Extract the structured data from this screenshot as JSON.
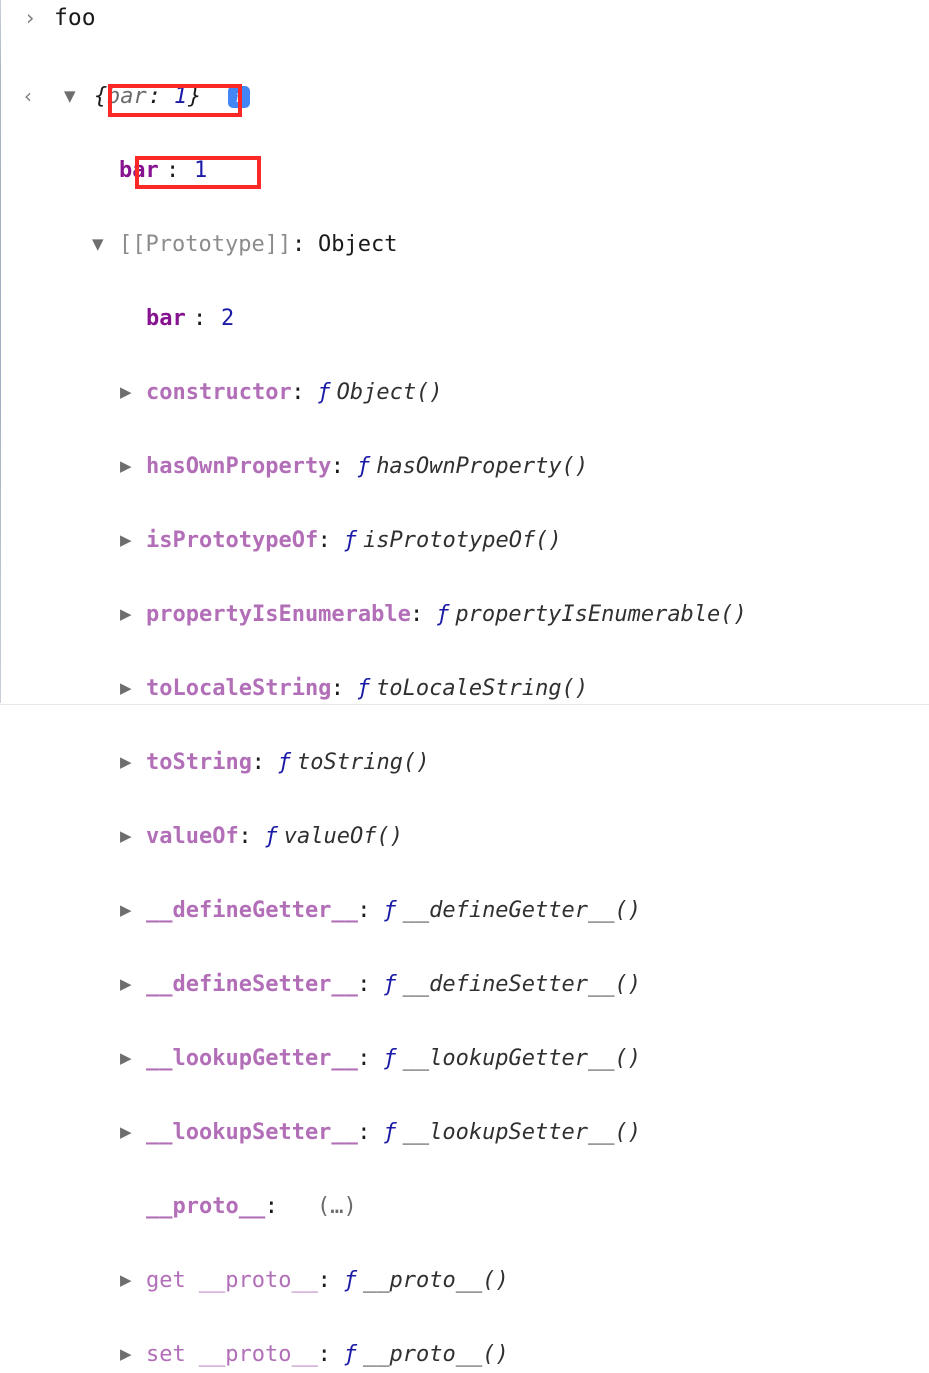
{
  "console": {
    "prompt_icon": "chevron-right",
    "result_icon": "chevron-left-dot",
    "input_expression": "foo",
    "result_preview": {
      "brace_open": "{",
      "key": "bar",
      "colon": ":",
      "value": "1",
      "brace_close": "}",
      "info_badge": "i"
    },
    "own_property": {
      "key": "bar",
      "colon": ":",
      "value": "1"
    },
    "prototype_header": {
      "label": "[[Prototype]]",
      "colon": ":",
      "type": "Object"
    },
    "prototype_own_property": {
      "key": "bar",
      "colon": ":",
      "value": "2"
    },
    "prototype_members": [
      {
        "key": "constructor",
        "colon": ":",
        "fn_mark": "ƒ",
        "value": "Object()",
        "expandable": true,
        "accessor": ""
      },
      {
        "key": "hasOwnProperty",
        "colon": ":",
        "fn_mark": "ƒ",
        "value": "hasOwnProperty()",
        "expandable": true,
        "accessor": ""
      },
      {
        "key": "isPrototypeOf",
        "colon": ":",
        "fn_mark": "ƒ",
        "value": "isPrototypeOf()",
        "expandable": true,
        "accessor": ""
      },
      {
        "key": "propertyIsEnumerable",
        "colon": ":",
        "fn_mark": "ƒ",
        "value": "propertyIsEnumerable()",
        "expandable": true,
        "accessor": ""
      },
      {
        "key": "toLocaleString",
        "colon": ":",
        "fn_mark": "ƒ",
        "value": "toLocaleString()",
        "expandable": true,
        "accessor": ""
      },
      {
        "key": "toString",
        "colon": ":",
        "fn_mark": "ƒ",
        "value": "toString()",
        "expandable": true,
        "accessor": ""
      },
      {
        "key": "valueOf",
        "colon": ":",
        "fn_mark": "ƒ",
        "value": "valueOf()",
        "expandable": true,
        "accessor": ""
      },
      {
        "key": "__defineGetter__",
        "colon": ":",
        "fn_mark": "ƒ",
        "value": "__defineGetter__()",
        "expandable": true,
        "accessor": ""
      },
      {
        "key": "__defineSetter__",
        "colon": ":",
        "fn_mark": "ƒ",
        "value": "__defineSetter__()",
        "expandable": true,
        "accessor": ""
      },
      {
        "key": "__lookupGetter__",
        "colon": ":",
        "fn_mark": "ƒ",
        "value": "__lookupGetter__()",
        "expandable": true,
        "accessor": ""
      },
      {
        "key": "__lookupSetter__",
        "colon": ":",
        "fn_mark": "ƒ",
        "value": "__lookupSetter__()",
        "expandable": true,
        "accessor": ""
      },
      {
        "key": "__proto__",
        "colon": ":",
        "fn_mark": "",
        "value": "(…)",
        "expandable": false,
        "accessor": ""
      },
      {
        "key": "__proto__",
        "colon": ":",
        "fn_mark": "ƒ",
        "value": "__proto__()",
        "expandable": true,
        "accessor": "get"
      },
      {
        "key": "__proto__",
        "colon": ":",
        "fn_mark": "ƒ",
        "value": "__proto__()",
        "expandable": true,
        "accessor": "set"
      }
    ]
  },
  "annotations": {
    "accent_color": "#fb2828",
    "boxes": [
      {
        "label": "highlight-own-bar-1"
      },
      {
        "label": "highlight-proto-bar-2"
      }
    ]
  },
  "icons": {
    "collapsed_triangle": "▶",
    "expanded_triangle": "▼",
    "prompt_chevron": "›",
    "result_chevron": "‹"
  }
}
